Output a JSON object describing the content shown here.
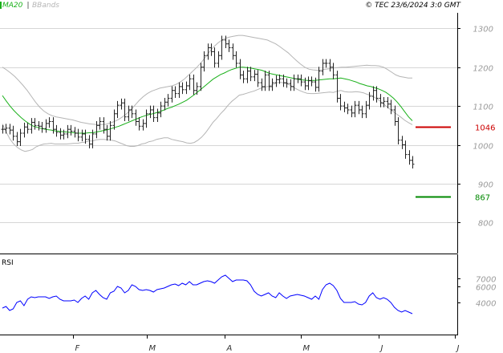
{
  "chart_data": [
    {
      "type": "ohlc",
      "header": {
        "ma_label": "MA20",
        "bbands_label": "BBands",
        "copyright": "© TEC 23/6/2024 3:0 GMT"
      },
      "ylim": [
        720,
        1340
      ],
      "y_ticks": [
        {
          "value": 800,
          "label": "800"
        },
        {
          "value": 900,
          "label": "900"
        },
        {
          "value": 1000,
          "label": "1000"
        },
        {
          "value": 1100,
          "label": "1100"
        },
        {
          "value": 1200,
          "label": "1200"
        },
        {
          "value": 1300,
          "label": "1300"
        }
      ],
      "x_ticks": [
        {
          "value": "2024-02-01",
          "label": "F"
        },
        {
          "value": "2024-03-01",
          "label": "M"
        },
        {
          "value": "2024-04-01",
          "label": "A"
        },
        {
          "value": "2024-05-01",
          "label": "M"
        },
        {
          "value": "2024-06-01",
          "label": "J"
        },
        {
          "value": "2024-07-01",
          "label": "J"
        }
      ],
      "x_range": [
        "2024-01-03",
        "2024-07-02"
      ],
      "close": [
        1040,
        1043,
        1038,
        1022,
        1008,
        1030,
        1046,
        1040,
        1058,
        1050,
        1048,
        1042,
        1055,
        1060,
        1040,
        1032,
        1025,
        1028,
        1040,
        1035,
        1030,
        1020,
        1028,
        1014,
        1002,
        1028,
        1050,
        1060,
        1040,
        1022,
        1050,
        1080,
        1102,
        1108,
        1072,
        1090,
        1080,
        1060,
        1048,
        1055,
        1080,
        1090,
        1070,
        1082,
        1100,
        1110,
        1120,
        1140,
        1132,
        1150,
        1142,
        1152,
        1170,
        1140,
        1150,
        1200,
        1230,
        1250,
        1240,
        1210,
        1230,
        1270,
        1260,
        1250,
        1230,
        1210,
        1180,
        1170,
        1190,
        1175,
        1182,
        1160,
        1150,
        1180,
        1150,
        1160,
        1168,
        1170,
        1160,
        1158,
        1150,
        1170,
        1170,
        1162,
        1152,
        1165,
        1162,
        1148,
        1190,
        1210,
        1210,
        1200,
        1180,
        1120,
        1100,
        1095,
        1090,
        1082,
        1102,
        1090,
        1080,
        1102,
        1125,
        1140,
        1120,
        1108,
        1112,
        1105,
        1090,
        1060,
        1012,
        1000,
        975,
        960,
        950
      ],
      "ma20": [
        1127,
        1113,
        1100,
        1089,
        1079,
        1070,
        1062,
        1055,
        1049,
        1046,
        1043,
        1041,
        1039,
        1038,
        1036,
        1035,
        1034,
        1033,
        1032,
        1031,
        1030,
        1030,
        1030,
        1031,
        1031,
        1033,
        1035,
        1037,
        1039,
        1042,
        1045,
        1048,
        1052,
        1056,
        1060,
        1064,
        1068,
        1072,
        1075,
        1078,
        1080,
        1083,
        1086,
        1090,
        1094,
        1097,
        1101,
        1105,
        1110,
        1115,
        1122,
        1129,
        1137,
        1145,
        1153,
        1161,
        1169,
        1175,
        1181,
        1185,
        1190,
        1194,
        1197,
        1200,
        1200,
        1199,
        1198,
        1196,
        1194,
        1192,
        1188,
        1184,
        1182,
        1180,
        1178,
        1176,
        1174,
        1172,
        1170,
        1168,
        1167,
        1166,
        1166,
        1166,
        1167,
        1168,
        1169,
        1170,
        1170,
        1171,
        1172,
        1170,
        1168,
        1165,
        1162,
        1158,
        1155,
        1152,
        1150,
        1147,
        1144,
        1140,
        1135,
        1128,
        1120,
        1110,
        1098,
        1085,
        1072,
        1062
      ],
      "upper_band": [
        1200,
        1193,
        1185,
        1176,
        1165,
        1153,
        1140,
        1125,
        1110,
        1097,
        1087,
        1080,
        1075,
        1072,
        1070,
        1068,
        1066,
        1064,
        1061,
        1058,
        1056,
        1054,
        1053,
        1052,
        1052,
        1053,
        1056,
        1060,
        1065,
        1072,
        1080,
        1090,
        1102,
        1114,
        1124,
        1132,
        1138,
        1142,
        1146,
        1148,
        1150,
        1152,
        1156,
        1162,
        1170,
        1180,
        1190,
        1200,
        1212,
        1225,
        1240,
        1252,
        1262,
        1270,
        1275,
        1278,
        1280,
        1282,
        1282,
        1280,
        1278,
        1276,
        1274,
        1272,
        1270,
        1265,
        1260,
        1253,
        1245,
        1237,
        1227,
        1217,
        1208,
        1200,
        1195,
        1193,
        1192,
        1193,
        1195,
        1196,
        1198,
        1199,
        1200,
        1200,
        1201,
        1202,
        1203,
        1204,
        1205,
        1204,
        1204,
        1203,
        1200,
        1194,
        1187,
        1180,
        1176,
        1174,
        1172,
        1172
      ],
      "lower_band": [
        1054,
        1033,
        1015,
        1002,
        993,
        987,
        983,
        985,
        988,
        995,
        999,
        1002,
        1003,
        1004,
        1002,
        1002,
        1002,
        1002,
        1003,
        1004,
        1004,
        1006,
        1007,
        1010,
        1010,
        1013,
        1014,
        1014,
        1013,
        1012,
        1010,
        1006,
        1002,
        998,
        996,
        996,
        998,
        1002,
        1004,
        1008,
        1010,
        1014,
        1016,
        1018,
        1018,
        1014,
        1012,
        1010,
        1008,
        1005,
        1004,
        1006,
        1012,
        1020,
        1031,
        1044,
        1058,
        1068,
        1080,
        1090,
        1102,
        1112,
        1120,
        1128,
        1130,
        1133,
        1136,
        1139,
        1143,
        1147,
        1149,
        1151,
        1156,
        1160,
        1161,
        1159,
        1156,
        1151,
        1145,
        1140,
        1136,
        1133,
        1132,
        1132,
        1133,
        1134,
        1135,
        1136,
        1135,
        1138,
        1140,
        1137,
        1136,
        1136,
        1137,
        1136,
        1134,
        1130,
        1128,
        1122,
        1116,
        1108,
        1100,
        1092,
        1085,
        1078,
        1071,
        1063,
        1057,
        1052
      ],
      "levels": [
        {
          "value": 1046,
          "label": "1046",
          "color": "#cc0000"
        },
        {
          "value": 867,
          "label": "867",
          "color": "#008800"
        }
      ]
    },
    {
      "type": "line",
      "title": "RSI",
      "ylim": [
        0,
        100
      ],
      "y_ticks": [
        {
          "value": 40,
          "label": "4000"
        },
        {
          "value": 60,
          "label": "6000"
        },
        {
          "value": 70,
          "label": "7000"
        }
      ],
      "values": [
        33,
        35,
        30,
        32,
        40,
        42,
        36,
        44,
        47,
        46,
        47,
        47,
        47,
        45,
        47,
        48,
        44,
        42,
        42,
        42,
        43,
        40,
        45,
        48,
        44,
        52,
        55,
        50,
        46,
        44,
        52,
        54,
        60,
        58,
        52,
        55,
        62,
        60,
        56,
        55,
        56,
        55,
        53,
        56,
        57,
        58,
        60,
        62,
        63,
        61,
        64,
        62,
        66,
        62,
        62,
        64,
        66,
        67,
        66,
        64,
        68,
        72,
        74,
        70,
        66,
        68,
        68,
        68,
        67,
        62,
        54,
        50,
        48,
        50,
        52,
        48,
        46,
        52,
        48,
        45,
        48,
        49,
        50,
        49,
        48,
        46,
        44,
        48,
        44,
        56,
        62,
        64,
        61,
        55,
        45,
        40,
        40,
        40,
        41,
        38,
        37,
        40,
        48,
        52,
        46,
        44,
        46,
        44,
        40,
        34,
        30,
        28,
        30,
        28,
        26
      ]
    }
  ],
  "colors": {
    "price_bar": "#222222",
    "ma20": "#19b019",
    "bbands": "#b5b5b5",
    "rsi_line": "#0000ff",
    "grid": "#d6d6d6",
    "frame": "#000000",
    "axis_text": "#9a9a9a"
  }
}
